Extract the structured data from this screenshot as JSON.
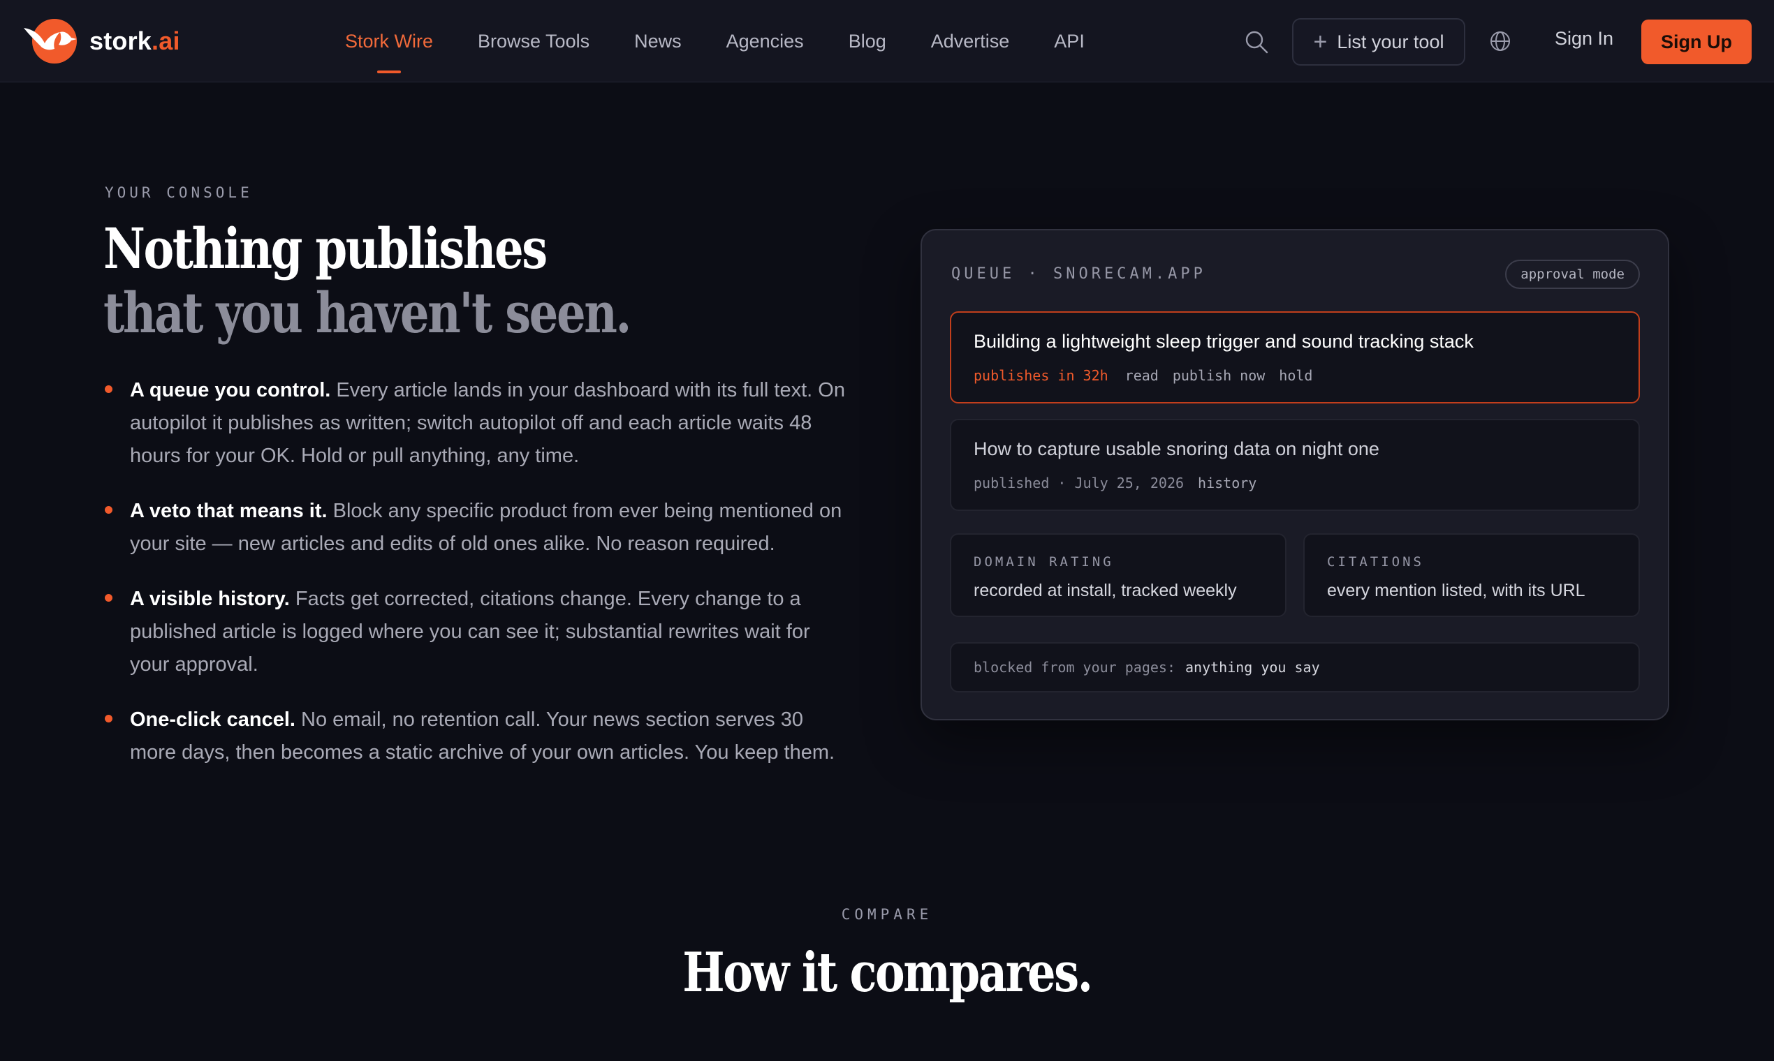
{
  "brand": {
    "name": "stork",
    "suffix": ".ai",
    "accent": "#f15a2b"
  },
  "nav": {
    "links": [
      {
        "label": "Stork Wire",
        "active": true
      },
      {
        "label": "Browse Tools",
        "active": false
      },
      {
        "label": "News",
        "active": false
      },
      {
        "label": "Agencies",
        "active": false
      },
      {
        "label": "Blog",
        "active": false
      },
      {
        "label": "Advertise",
        "active": false
      },
      {
        "label": "API",
        "active": false
      }
    ],
    "list_tool": "List your tool",
    "sign_in": "Sign In",
    "sign_up": "Sign Up"
  },
  "hero": {
    "eyebrow": "YOUR CONSOLE",
    "title_line1": "Nothing publishes",
    "title_line2": "that you haven't seen.",
    "bullets": [
      {
        "lead": "A queue you control.",
        "text": "Every article lands in your dashboard with its full text. On autopilot it publishes as written; switch autopilot off and each article waits 48 hours for your OK. Hold or pull anything, any time."
      },
      {
        "lead": "A veto that means it.",
        "text": "Block any specific product from ever being mentioned on your site — new articles and edits of old ones alike. No reason required."
      },
      {
        "lead": "A visible history.",
        "text": "Facts get corrected, citations change. Every change to a published article is logged where you can see it; substantial rewrites wait for your approval."
      },
      {
        "lead": "One-click cancel.",
        "text": "No email, no retention call. Your news section serves 30 more days, then becomes a static archive of your own articles. You keep them."
      }
    ]
  },
  "queue": {
    "header": "QUEUE · SNORECAM.APP",
    "mode_badge": "approval mode",
    "items": [
      {
        "title": "Building a lightweight sleep trigger and sound tracking stack",
        "status": "publishes in 32h",
        "actions": [
          "read",
          "publish now",
          "hold"
        ]
      },
      {
        "title": "How to capture usable snoring data on night one",
        "status": "published · July 25, 2026",
        "actions": [
          "history"
        ]
      }
    ],
    "domain_rating": {
      "label": "DOMAIN RATING",
      "value": "recorded at install, tracked weekly"
    },
    "citations": {
      "label": "CITATIONS",
      "value": "every mention listed, with its URL"
    },
    "blocked": {
      "label": "blocked from your pages:",
      "value": "anything you say"
    }
  },
  "compare": {
    "eyebrow": "COMPARE",
    "title": "How it compares."
  }
}
